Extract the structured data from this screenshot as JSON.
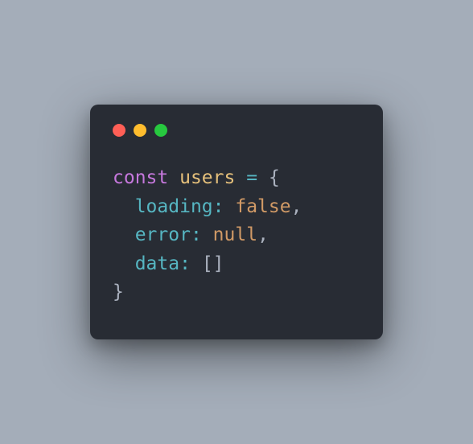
{
  "window": {
    "controls": {
      "close": "close",
      "minimize": "minimize",
      "maximize": "maximize"
    }
  },
  "code": {
    "line1": {
      "keyword": "const",
      "ident": "users",
      "eq": "=",
      "brace": "{"
    },
    "line2": {
      "indent": "  ",
      "prop": "loading",
      "colon": ":",
      "value": "false",
      "comma": ","
    },
    "line3": {
      "indent": "  ",
      "prop": "error",
      "colon": ":",
      "value": "null",
      "comma": ","
    },
    "line4": {
      "indent": "  ",
      "prop": "data",
      "colon": ":",
      "value": "[]"
    },
    "line5": {
      "brace": "}"
    }
  }
}
